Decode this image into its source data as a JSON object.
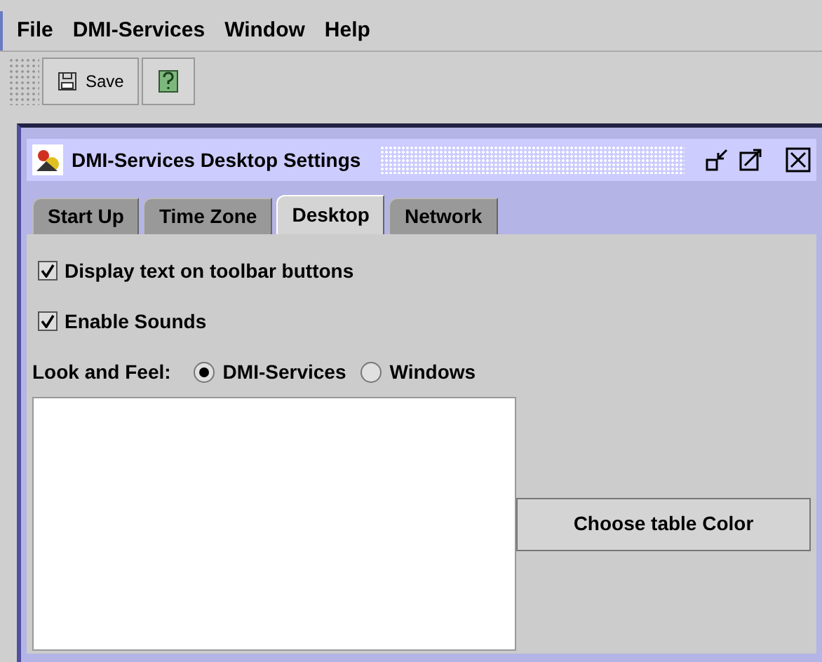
{
  "menu": [
    "File",
    "DMI-Services",
    "Window",
    "Help"
  ],
  "toolbar": {
    "save": "Save"
  },
  "frame": {
    "title": "DMI-Services Desktop Settings",
    "tabs": [
      {
        "label": "Start Up",
        "selected": false
      },
      {
        "label": "Time Zone",
        "selected": false
      },
      {
        "label": "Desktop",
        "selected": true
      },
      {
        "label": "Network",
        "selected": false
      }
    ],
    "options": [
      {
        "label": "Display text on toolbar buttons",
        "checked": true
      },
      {
        "label": "Enable Sounds",
        "checked": true
      }
    ],
    "look_and_feel": {
      "label": "Look and Feel:",
      "choices": [
        {
          "label": "DMI-Services",
          "selected": true
        },
        {
          "label": "Windows",
          "selected": false
        }
      ]
    },
    "button": "Choose table Color"
  }
}
